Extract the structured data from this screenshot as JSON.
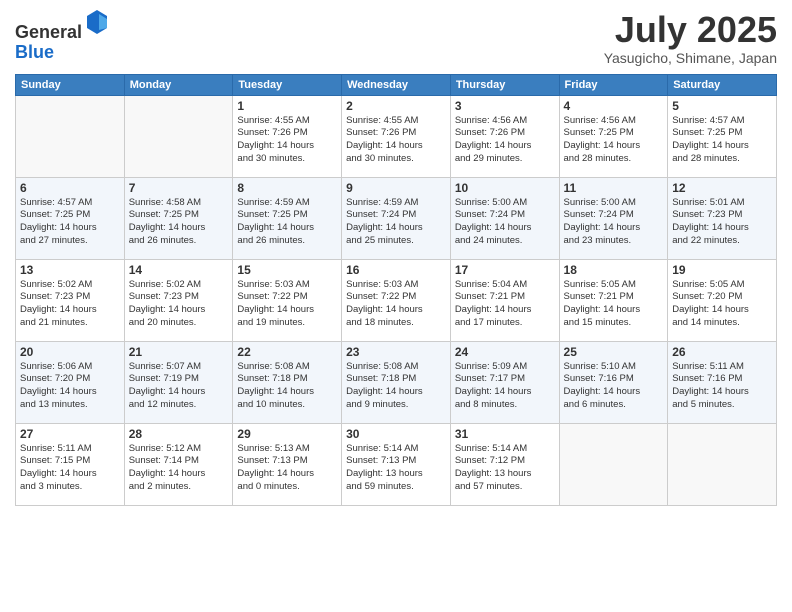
{
  "header": {
    "logo_line1": "General",
    "logo_line2": "Blue",
    "month": "July 2025",
    "location": "Yasugicho, Shimane, Japan"
  },
  "weekdays": [
    "Sunday",
    "Monday",
    "Tuesday",
    "Wednesday",
    "Thursday",
    "Friday",
    "Saturday"
  ],
  "weeks": [
    [
      {
        "day": "",
        "info": ""
      },
      {
        "day": "",
        "info": ""
      },
      {
        "day": "1",
        "info": "Sunrise: 4:55 AM\nSunset: 7:26 PM\nDaylight: 14 hours\nand 30 minutes."
      },
      {
        "day": "2",
        "info": "Sunrise: 4:55 AM\nSunset: 7:26 PM\nDaylight: 14 hours\nand 30 minutes."
      },
      {
        "day": "3",
        "info": "Sunrise: 4:56 AM\nSunset: 7:26 PM\nDaylight: 14 hours\nand 29 minutes."
      },
      {
        "day": "4",
        "info": "Sunrise: 4:56 AM\nSunset: 7:25 PM\nDaylight: 14 hours\nand 28 minutes."
      },
      {
        "day": "5",
        "info": "Sunrise: 4:57 AM\nSunset: 7:25 PM\nDaylight: 14 hours\nand 28 minutes."
      }
    ],
    [
      {
        "day": "6",
        "info": "Sunrise: 4:57 AM\nSunset: 7:25 PM\nDaylight: 14 hours\nand 27 minutes."
      },
      {
        "day": "7",
        "info": "Sunrise: 4:58 AM\nSunset: 7:25 PM\nDaylight: 14 hours\nand 26 minutes."
      },
      {
        "day": "8",
        "info": "Sunrise: 4:59 AM\nSunset: 7:25 PM\nDaylight: 14 hours\nand 26 minutes."
      },
      {
        "day": "9",
        "info": "Sunrise: 4:59 AM\nSunset: 7:24 PM\nDaylight: 14 hours\nand 25 minutes."
      },
      {
        "day": "10",
        "info": "Sunrise: 5:00 AM\nSunset: 7:24 PM\nDaylight: 14 hours\nand 24 minutes."
      },
      {
        "day": "11",
        "info": "Sunrise: 5:00 AM\nSunset: 7:24 PM\nDaylight: 14 hours\nand 23 minutes."
      },
      {
        "day": "12",
        "info": "Sunrise: 5:01 AM\nSunset: 7:23 PM\nDaylight: 14 hours\nand 22 minutes."
      }
    ],
    [
      {
        "day": "13",
        "info": "Sunrise: 5:02 AM\nSunset: 7:23 PM\nDaylight: 14 hours\nand 21 minutes."
      },
      {
        "day": "14",
        "info": "Sunrise: 5:02 AM\nSunset: 7:23 PM\nDaylight: 14 hours\nand 20 minutes."
      },
      {
        "day": "15",
        "info": "Sunrise: 5:03 AM\nSunset: 7:22 PM\nDaylight: 14 hours\nand 19 minutes."
      },
      {
        "day": "16",
        "info": "Sunrise: 5:03 AM\nSunset: 7:22 PM\nDaylight: 14 hours\nand 18 minutes."
      },
      {
        "day": "17",
        "info": "Sunrise: 5:04 AM\nSunset: 7:21 PM\nDaylight: 14 hours\nand 17 minutes."
      },
      {
        "day": "18",
        "info": "Sunrise: 5:05 AM\nSunset: 7:21 PM\nDaylight: 14 hours\nand 15 minutes."
      },
      {
        "day": "19",
        "info": "Sunrise: 5:05 AM\nSunset: 7:20 PM\nDaylight: 14 hours\nand 14 minutes."
      }
    ],
    [
      {
        "day": "20",
        "info": "Sunrise: 5:06 AM\nSunset: 7:20 PM\nDaylight: 14 hours\nand 13 minutes."
      },
      {
        "day": "21",
        "info": "Sunrise: 5:07 AM\nSunset: 7:19 PM\nDaylight: 14 hours\nand 12 minutes."
      },
      {
        "day": "22",
        "info": "Sunrise: 5:08 AM\nSunset: 7:18 PM\nDaylight: 14 hours\nand 10 minutes."
      },
      {
        "day": "23",
        "info": "Sunrise: 5:08 AM\nSunset: 7:18 PM\nDaylight: 14 hours\nand 9 minutes."
      },
      {
        "day": "24",
        "info": "Sunrise: 5:09 AM\nSunset: 7:17 PM\nDaylight: 14 hours\nand 8 minutes."
      },
      {
        "day": "25",
        "info": "Sunrise: 5:10 AM\nSunset: 7:16 PM\nDaylight: 14 hours\nand 6 minutes."
      },
      {
        "day": "26",
        "info": "Sunrise: 5:11 AM\nSunset: 7:16 PM\nDaylight: 14 hours\nand 5 minutes."
      }
    ],
    [
      {
        "day": "27",
        "info": "Sunrise: 5:11 AM\nSunset: 7:15 PM\nDaylight: 14 hours\nand 3 minutes."
      },
      {
        "day": "28",
        "info": "Sunrise: 5:12 AM\nSunset: 7:14 PM\nDaylight: 14 hours\nand 2 minutes."
      },
      {
        "day": "29",
        "info": "Sunrise: 5:13 AM\nSunset: 7:13 PM\nDaylight: 14 hours\nand 0 minutes."
      },
      {
        "day": "30",
        "info": "Sunrise: 5:14 AM\nSunset: 7:13 PM\nDaylight: 13 hours\nand 59 minutes."
      },
      {
        "day": "31",
        "info": "Sunrise: 5:14 AM\nSunset: 7:12 PM\nDaylight: 13 hours\nand 57 minutes."
      },
      {
        "day": "",
        "info": ""
      },
      {
        "day": "",
        "info": ""
      }
    ]
  ]
}
